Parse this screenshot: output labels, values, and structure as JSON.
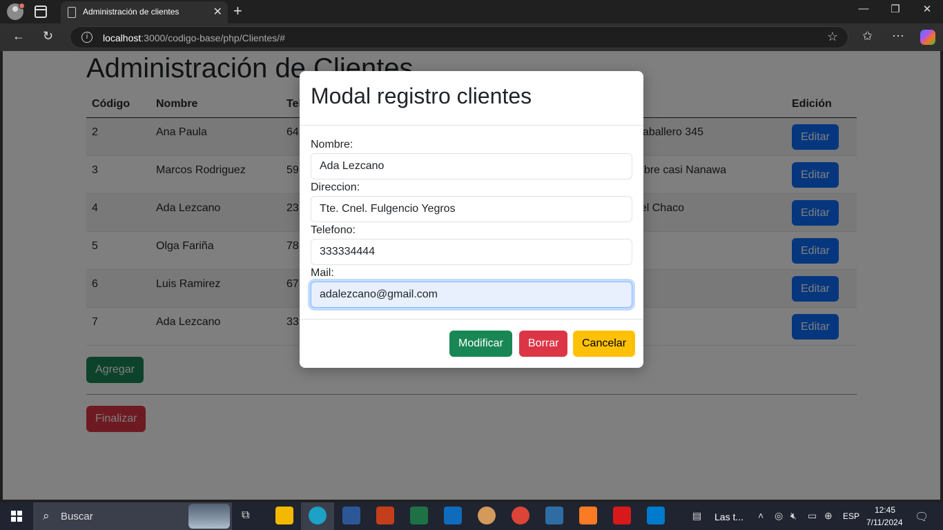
{
  "browser": {
    "tab_title": "Administración de clientes",
    "url_host": "localhost",
    "url_path": ":3000/codigo-base/php/Clientes/#"
  },
  "page": {
    "title": "Administración de Clientes",
    "columns": [
      "Código",
      "Nombre",
      "Tel",
      "Edición"
    ],
    "rows": [
      {
        "codigo": "2",
        "nombre": "Ana Paula",
        "telefono": "64",
        "direccion": "aballero 345",
        "edit_label": "Editar"
      },
      {
        "codigo": "3",
        "nombre": "Marcos Rodriguez",
        "telefono": "59",
        "direccion": "mbre casi Nanawa",
        "edit_label": "Editar"
      },
      {
        "codigo": "4",
        "nombre": "Ada Lezcano",
        "telefono": "23",
        "direccion": "el Chaco",
        "edit_label": "Editar"
      },
      {
        "codigo": "5",
        "nombre": "Olga Fariña",
        "telefono": "78",
        "direccion": "",
        "edit_label": "Editar"
      },
      {
        "codigo": "6",
        "nombre": "Luis Ramirez",
        "telefono": "67",
        "direccion": "",
        "edit_label": "Editar"
      },
      {
        "codigo": "7",
        "nombre": "Ada Lezcano",
        "telefono": "33",
        "direccion": "",
        "edit_label": "Editar"
      }
    ],
    "add_label": "Agregar",
    "finish_label": "Finalizar"
  },
  "modal": {
    "title": "Modal registro clientes",
    "fields": {
      "nombre": {
        "label": "Nombre:",
        "value": "Ada Lezcano"
      },
      "direccion": {
        "label": "Direccion:",
        "value": "Tte. Cnel. Fulgencio Yegros"
      },
      "telefono": {
        "label": "Telefono:",
        "value": "333334444"
      },
      "mail": {
        "label": "Mail:",
        "value": "adalezcano@gmail.com"
      }
    },
    "buttons": {
      "modify": "Modificar",
      "delete": "Borrar",
      "cancel": "Cancelar"
    }
  },
  "taskbar": {
    "search_placeholder": "Buscar",
    "widget_text": "Las t...",
    "language": "ESP",
    "time": "12:45",
    "date": "7/11/2024"
  },
  "colors": {
    "primary": "#0d6efd",
    "success": "#198754",
    "danger": "#dc3545",
    "warning": "#ffc107"
  }
}
